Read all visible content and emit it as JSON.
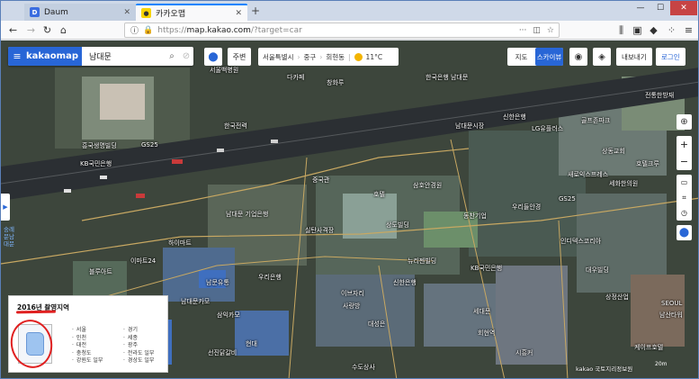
{
  "browser": {
    "tabs": [
      {
        "title": "Daum",
        "icon": "daum-favicon"
      },
      {
        "title": "카카오맵",
        "icon": "kakaomap-favicon"
      }
    ],
    "url_protocol": "https://",
    "url_host": "map.kakao.com",
    "url_path": "/?target=car"
  },
  "map": {
    "logo": "kakaomap",
    "search_value": "남대문",
    "nearby_label": "주변",
    "location": {
      "city": "서울특별시",
      "district": "중구",
      "dong": "회현동",
      "temperature": "11°C"
    },
    "map_types": [
      "지도",
      "스카이뷰"
    ],
    "active_map_type": "스카이뷰",
    "share_label": "내보내기",
    "login_label": "로그인",
    "side_note": "숭례문남대문",
    "labels": {
      "l1": "서울백병원",
      "l2": "다카페",
      "l3": "창화루",
      "l4": "한국은행 남대문",
      "l5": "한국전력",
      "l6": "흥국생명빌딩",
      "l7": "GS25",
      "l8": "KB국민은행",
      "l9": "신한은행",
      "l10": "LG유플러스",
      "l11": "골프존파크",
      "l12": "전통한방재",
      "l13": "상동교회",
      "l14": "호텔크루",
      "l15": "새로익스프레스",
      "l16": "세화한의원",
      "l17": "남대문시장",
      "l18": "중국관",
      "l19": "호텔",
      "l20": "삼호안경원",
      "l21": "동찬기업",
      "l22": "우리들안경",
      "l23": "GS25",
      "l24": "인디텍스코리아",
      "l25": "남대문 기업은행",
      "l26": "실탄사격장",
      "l27": "상도빌딩",
      "l28": "KB국민은행",
      "l29": "신한은행",
      "l30": "이브자리",
      "l31": "사랑방",
      "l32": "대성은",
      "l33": "세대문",
      "l34": "회현역",
      "l35": "수도상사",
      "l36": "시흥커",
      "l37": "케이프호텔",
      "l38": "뉴리젠빌딩",
      "l39": "우리은행",
      "l40": "남문유통",
      "l41": "하이마트",
      "l42": "이마트24",
      "l43": "블루아트",
      "l44": "삼익카모",
      "l45": "남대문카모",
      "l46": "현대",
      "l47": "선진닭갈비",
      "l48": "상정산업",
      "l49": "남산타워",
      "l50": "SEOUL",
      "l51": "대우빌딩"
    },
    "legend": {
      "title": "2016년 촬영지역",
      "col1": [
        "서울",
        "인천",
        "대전",
        "충청도",
        "강원도 일부"
      ],
      "col2": [
        "경기",
        "세종",
        "광주",
        "전라도 일부",
        "경상도 일부"
      ]
    },
    "copyright": "kakao 국토지리정보원",
    "scale": "20m"
  }
}
